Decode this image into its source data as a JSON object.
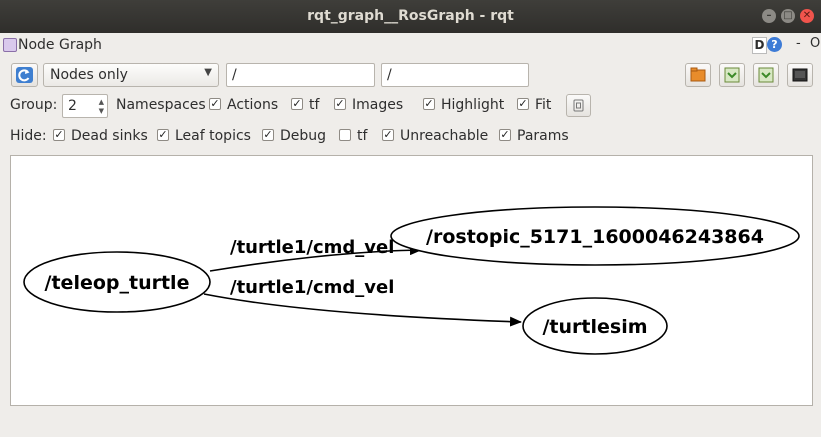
{
  "window": {
    "title": "rqt_graph__RosGraph - rqt"
  },
  "plugin": {
    "title": "Node Graph",
    "d_label": "D",
    "help_label": "?",
    "min_label": "-",
    "float_label": "O"
  },
  "toolbar": {
    "filter_mode": "Nodes only",
    "include_filter": "/",
    "exclude_filter": "/"
  },
  "options": {
    "group_label": "Group:",
    "group_value": "2",
    "namespaces_label": "Namespaces",
    "actions": {
      "label": "Actions",
      "checked": true
    },
    "tf": {
      "label": "tf",
      "checked": true
    },
    "images": {
      "label": "Images",
      "checked": true
    },
    "highlight": {
      "label": "Highlight",
      "checked": true
    },
    "fit": {
      "label": "Fit",
      "checked": true
    }
  },
  "hide": {
    "label": "Hide:",
    "dead_sinks": {
      "label": "Dead sinks",
      "checked": true
    },
    "leaf_topics": {
      "label": "Leaf topics",
      "checked": true
    },
    "debug": {
      "label": "Debug",
      "checked": true
    },
    "tf": {
      "label": "tf",
      "checked": false
    },
    "unreachable": {
      "label": "Unreachable",
      "checked": true
    },
    "params": {
      "label": "Params",
      "checked": true
    }
  },
  "graph": {
    "nodes": [
      "/teleop_turtle",
      "/rostopic_5171_1600046243864",
      "/turtlesim"
    ],
    "edges": [
      {
        "from": "/teleop_turtle",
        "to": "/rostopic_5171_1600046243864",
        "label": "/turtle1/cmd_vel"
      },
      {
        "from": "/teleop_turtle",
        "to": "/turtlesim",
        "label": "/turtle1/cmd_vel"
      }
    ]
  }
}
